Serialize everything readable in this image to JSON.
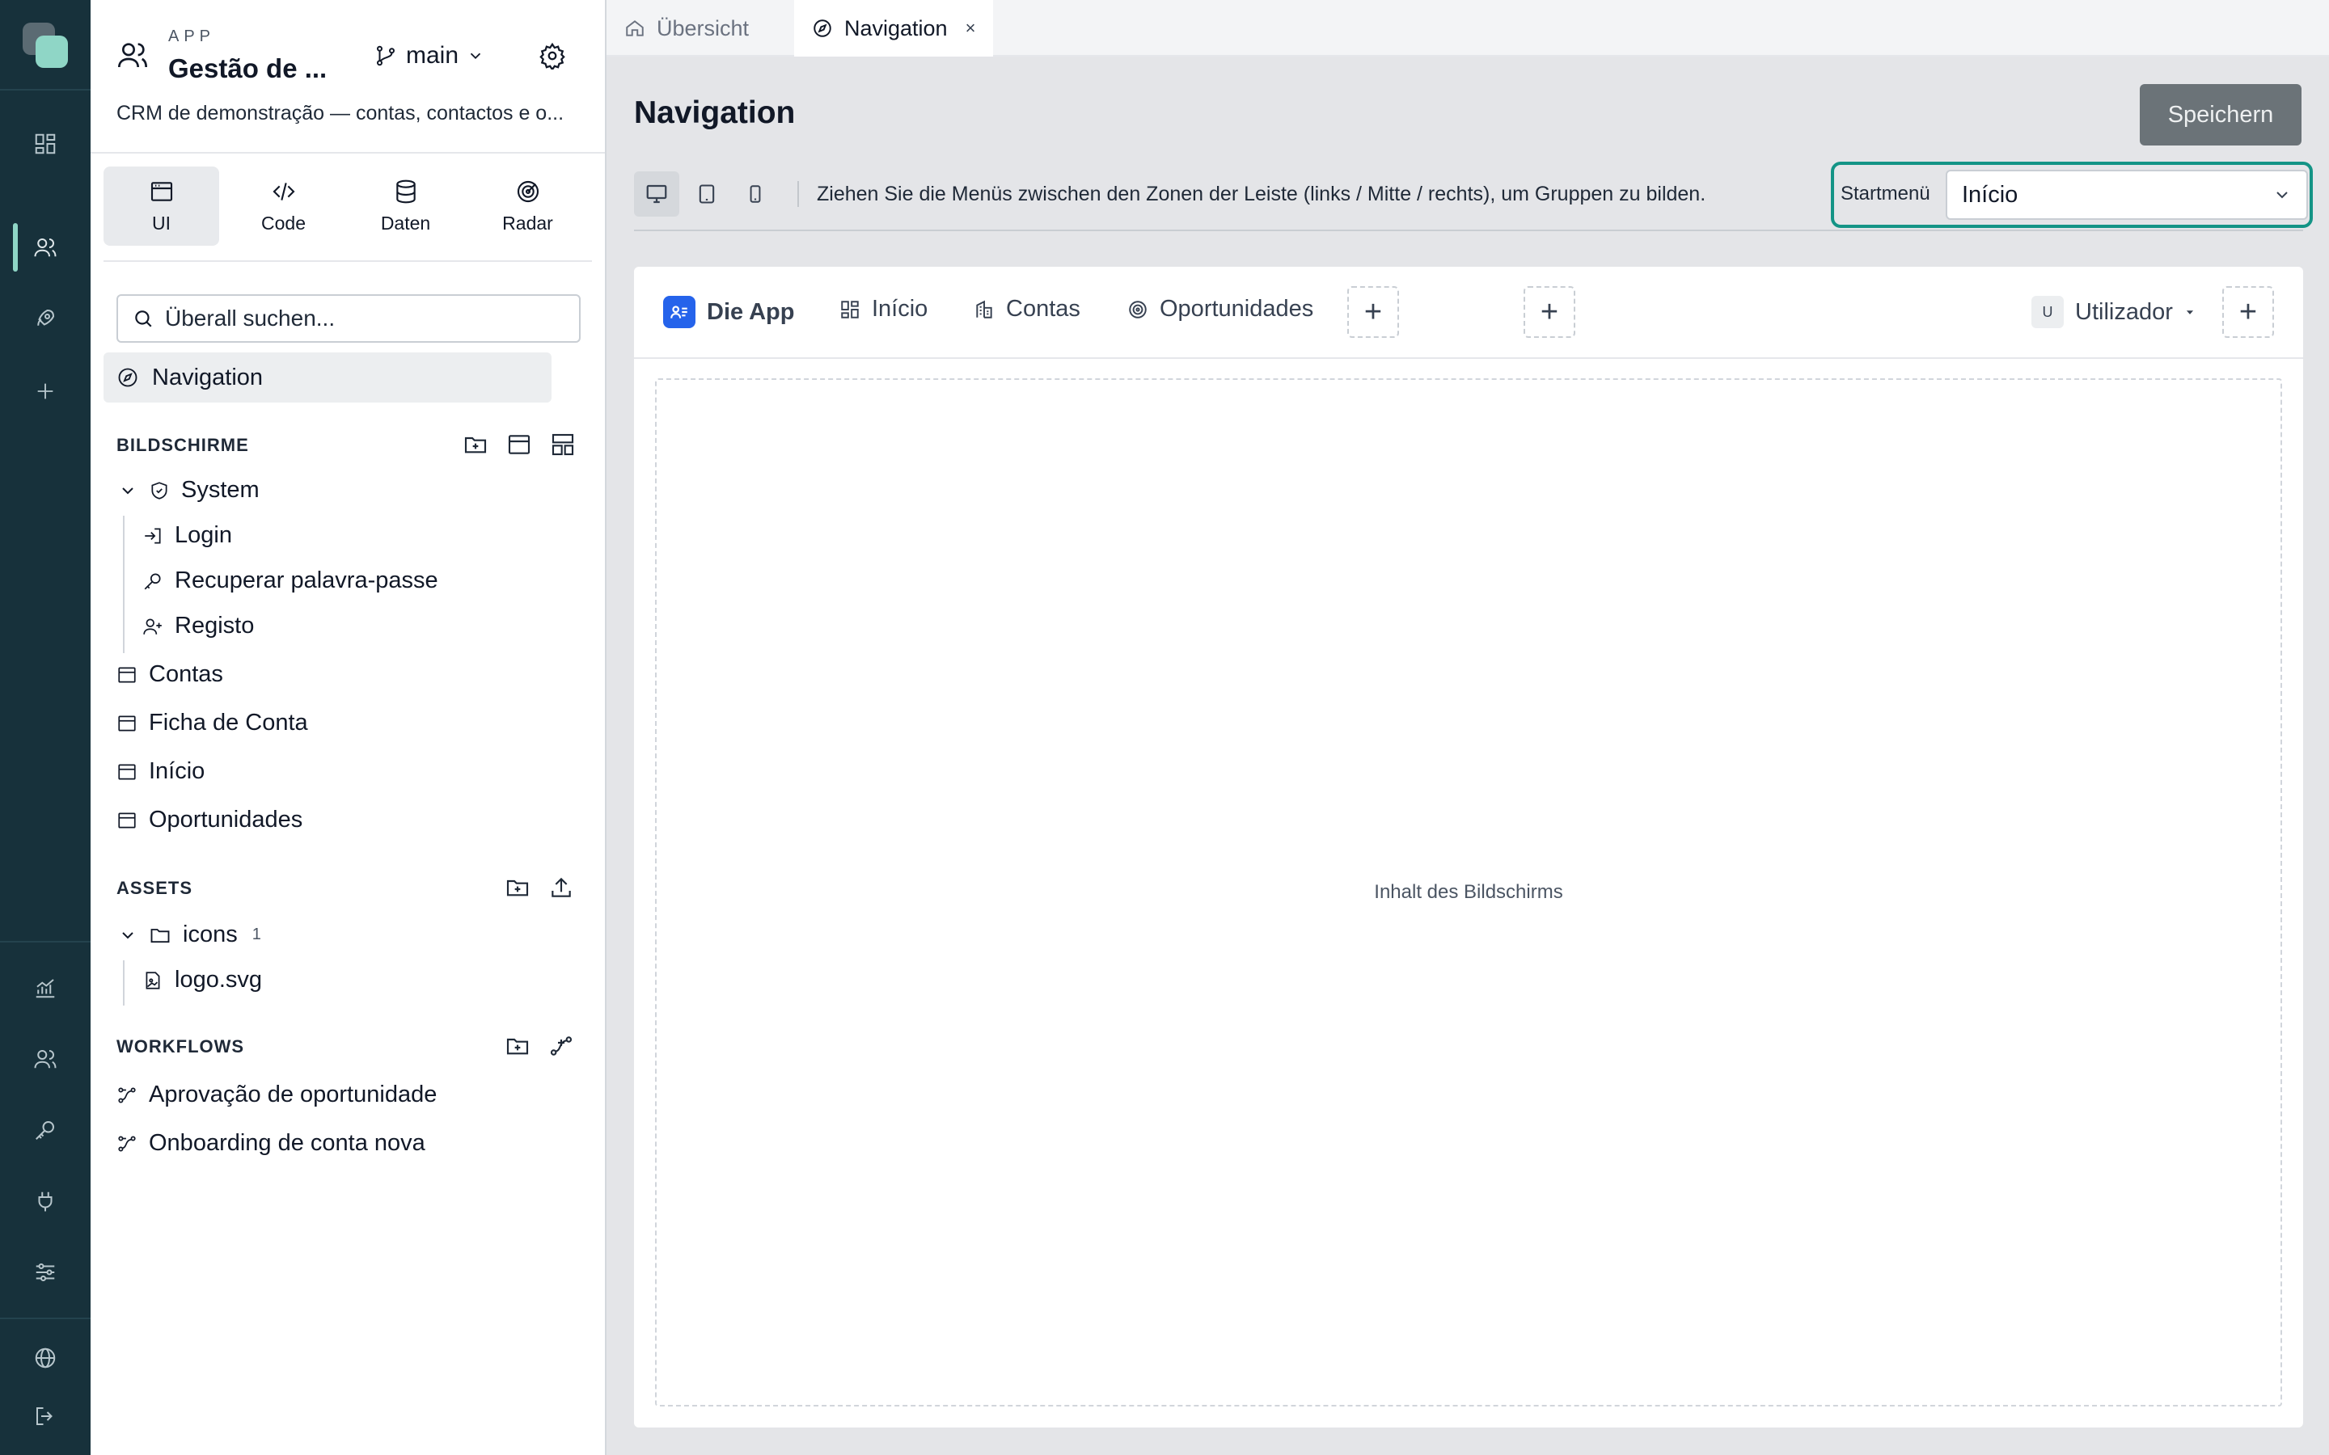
{
  "app": {
    "kicker": "APP",
    "title": "Gestão de ...",
    "branch": "main",
    "description": "CRM de demonstração — contas, contactos e o..."
  },
  "modes": [
    {
      "label": "UI",
      "icon": "browser-window-icon"
    },
    {
      "label": "Code",
      "icon": "code-icon"
    },
    {
      "label": "Daten",
      "icon": "database-icon"
    },
    {
      "label": "Radar",
      "icon": "radar-icon"
    }
  ],
  "search": {
    "placeholder": "Überall suchen..."
  },
  "nav_item": "Navigation",
  "screens": {
    "title": "BILDSCHIRME",
    "system_folder": "System",
    "system_items": [
      "Login",
      "Recuperar palavra-passe",
      "Registo"
    ],
    "items": [
      "Contas",
      "Ficha de Conta",
      "Início",
      "Oportunidades"
    ]
  },
  "assets": {
    "title": "ASSETS",
    "folder": "icons",
    "folder_count": "1",
    "files": [
      "logo.svg"
    ]
  },
  "workflows": {
    "title": "WORKFLOWS",
    "items": [
      "Aprovação de oportunidade",
      "Onboarding de conta nova"
    ]
  },
  "tabs": [
    {
      "label": "Übersicht",
      "icon": "home-icon",
      "active": false
    },
    {
      "label": "Navigation",
      "icon": "compass-icon",
      "active": true,
      "close": "×"
    }
  ],
  "main": {
    "title": "Navigation",
    "save_label": "Speichern",
    "hint": "Ziehen Sie die Menüs zwischen den Zonen der Leiste (links / Mitte / rechts), um Gruppen zu bilden.",
    "start_menu_label": "Startmenü",
    "start_menu_value": "Início"
  },
  "menubar": {
    "brand": "Die App",
    "items": [
      "Início",
      "Contas",
      "Oportunidades"
    ],
    "user_badge": "U",
    "user_label": "Utilizador",
    "add_symbol": "+"
  },
  "canvas": {
    "placeholder": "Inhalt des Bildschirms"
  },
  "colors": {
    "rail_bg": "#17313b",
    "accent": "#8fd6c6",
    "highlight_border": "#149486",
    "brand_blue": "#2563eb",
    "save_button": "#6b7378"
  }
}
